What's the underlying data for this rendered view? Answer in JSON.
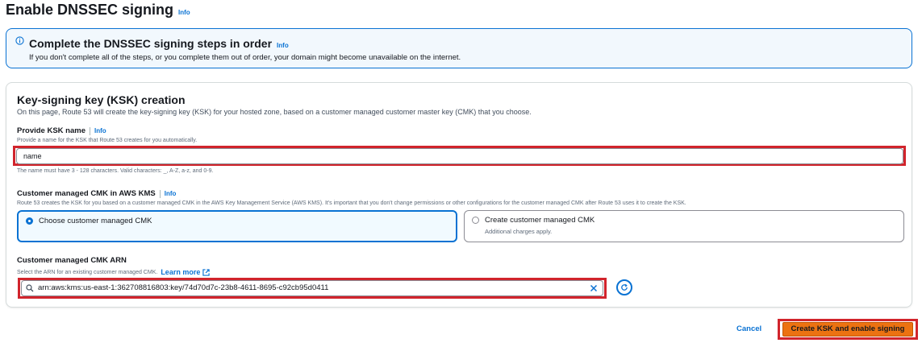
{
  "page": {
    "title": "Enable DNSSEC signing",
    "info_label": "Info"
  },
  "alert": {
    "title": "Complete the DNSSEC signing steps in order",
    "info_label": "Info",
    "body": "If you don't complete all of the steps, or you complete them out of order, your domain might become unavailable on the internet."
  },
  "ksk_section": {
    "title": "Key-signing key (KSK) creation",
    "description": "On this page, Route 53 will create the key-signing key (KSK) for your hosted zone, based on a customer managed customer master key (CMK) that you choose."
  },
  "ksk_name": {
    "label": "Provide KSK name",
    "info_label": "Info",
    "description": "Provide a name for the KSK that Route 53 creates for you automatically.",
    "value": "name",
    "constraint": "The name must have 3 - 128 characters. Valid characters: _, A-Z, a-z, and 0-9."
  },
  "cmk_kms": {
    "label": "Customer managed CMK in AWS KMS",
    "info_label": "Info",
    "description": "Route 53 creates the KSK for you based on a customer managed CMK in the AWS Key Management Service (AWS KMS). It's important that you don't change permissions or other configurations for the customer managed CMK after Route 53 uses it to create the KSK.",
    "options": [
      {
        "label": "Choose customer managed CMK",
        "sublabel": "",
        "selected": true
      },
      {
        "label": "Create customer managed CMK",
        "sublabel": "Additional charges apply.",
        "selected": false
      }
    ]
  },
  "cmk_arn": {
    "label": "Customer managed CMK ARN",
    "description": "Select the ARN for an existing customer managed CMK.",
    "learn_more": "Learn more",
    "value": "arn:aws:kms:us-east-1:362708816803:key/74d70d7c-23b8-4611-8695-c92cb95d0411"
  },
  "footer": {
    "cancel_label": "Cancel",
    "submit_label": "Create KSK and enable signing"
  },
  "colors": {
    "accent": "#0972d3",
    "highlight": "#d1242c",
    "primary_button": "#ec7211"
  }
}
